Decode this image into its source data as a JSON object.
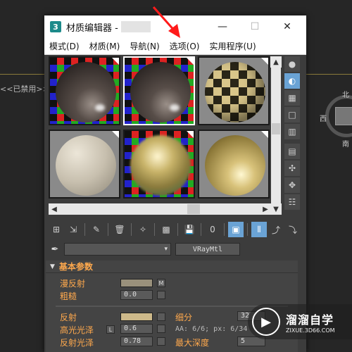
{
  "viewport": {
    "left_label": "<<已禁用>>",
    "gizmo_labels": [
      "北",
      "西",
      "南"
    ]
  },
  "window": {
    "app_icon": "3",
    "title": "材质编辑器 -",
    "controls": [
      "—",
      "☐",
      "✕"
    ]
  },
  "menu": {
    "items": [
      "模式(D)",
      "材质(M)",
      "导航(N)",
      "选项(O)",
      "实用程序(U)"
    ]
  },
  "material": {
    "type": "VRayMtl"
  },
  "params": {
    "rollout_title": "基本参数",
    "diffuse_label": "漫反射",
    "diffuse_m": "M",
    "roughness_label": "粗糙",
    "roughness_value": "0.0",
    "reflect_label": "反射",
    "subdiv_label": "细分",
    "subdiv_value": "32",
    "gloss_label": "高光光泽",
    "gloss_lock": "L",
    "gloss_value": "0.6",
    "aa_text": "AA: 6/6; px: 6/34",
    "reflgloss_label": "反射光泽",
    "reflgloss_value": "0.78",
    "maxdepth_label": "最大深度",
    "maxdepth_value": "5"
  },
  "watermark": {
    "name": "溜溜自学",
    "url": "ZIXUE.3D66.COM"
  },
  "colors": {
    "accent": "#6aa3d5",
    "label_orange": "#ffa94d",
    "diffuse_swatch": "#9a917c",
    "reflect_swatch": "#cdb98a"
  }
}
